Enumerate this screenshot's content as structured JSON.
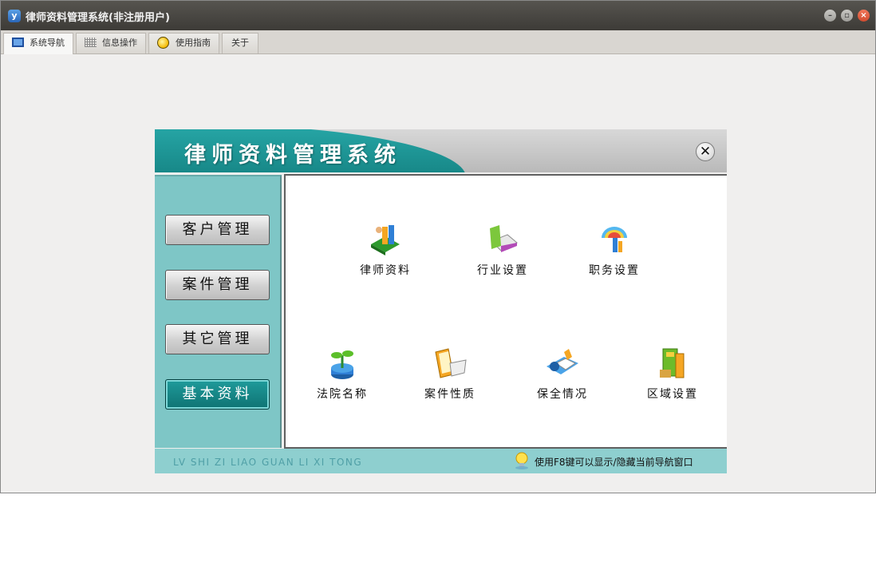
{
  "window": {
    "icon_glyph": "y",
    "title": "律师资料管理系统(非注册用户)",
    "controls": [
      "minimize-icon",
      "maximize-icon",
      "close-icon"
    ]
  },
  "tabs": [
    {
      "label": "系统导航",
      "icon": "monitor-icon",
      "active": true
    },
    {
      "label": "信息操作",
      "icon": "grid-icon",
      "active": false
    },
    {
      "label": "使用指南",
      "icon": "help-circle-icon",
      "active": false
    },
    {
      "label": "关于",
      "icon": "",
      "active": false
    }
  ],
  "panel": {
    "title": "律师资料管理系统",
    "close_glyph": "✕"
  },
  "sidebar": {
    "items": [
      {
        "label": "客户管理",
        "selected": false
      },
      {
        "label": "案件管理",
        "selected": false
      },
      {
        "label": "其它管理",
        "selected": false
      },
      {
        "label": "基本资料",
        "selected": true
      }
    ]
  },
  "content": {
    "items": [
      {
        "label": "律师资料",
        "icon": "lawyer-book-icon"
      },
      {
        "label": "行业设置",
        "icon": "industry-book-icon"
      },
      {
        "label": "职务设置",
        "icon": "position-umbrella-icon"
      },
      {
        "label": "法院名称",
        "icon": "court-plant-icon"
      },
      {
        "label": "案件性质",
        "icon": "case-folder-icon"
      },
      {
        "label": "保全情况",
        "icon": "preservation-icon"
      },
      {
        "label": "区域设置",
        "icon": "region-book-icon"
      }
    ]
  },
  "footer": {
    "left_text": "LV SHI ZI LIAO GUAN LI XI TONG",
    "hint_text": "使用F8键可以显示/隐藏当前导航窗口",
    "hint_icon": "lightbulb-icon"
  },
  "colors": {
    "accent": "#168585",
    "sidebar": "#7ec6c6",
    "footer": "#8ecfcf"
  }
}
